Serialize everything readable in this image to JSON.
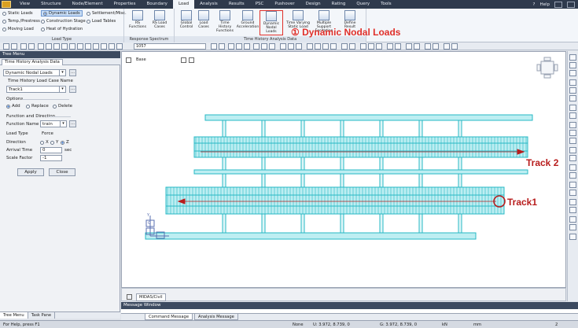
{
  "menubar": {
    "items": [
      "View",
      "Structure",
      "Node/Element",
      "Properties",
      "Boundary",
      "Load",
      "Analysis",
      "Results",
      "PSC",
      "Pushover",
      "Design",
      "Rating",
      "Query",
      "Tools"
    ],
    "active_index": 5,
    "help_label": "Help"
  },
  "ribbon": {
    "load_type": {
      "title": "Load Type",
      "items": [
        "Static Loads",
        "Dynamic Loads",
        "Settlement/Misc.",
        "Temp./Prestress",
        "Construction Stage",
        "Load Tables",
        "Moving Load",
        "Heat of Hydration"
      ],
      "selected": "Dynamic Loads"
    },
    "response_spectrum": {
      "title": "Response Spectrum Data",
      "buttons": [
        "RS Functions",
        "RS Load Cases"
      ]
    },
    "time_history": {
      "title": "Time History Analysis Data",
      "buttons": [
        "Global Control",
        "Load Cases",
        "Time History Functions",
        "Ground Acceleration",
        "Dynamic Nodal Loads",
        "Time Varying Static Load",
        "Multiple Support Excitation",
        "Define Result"
      ]
    },
    "callout": "① Dynamic Nodal Loads"
  },
  "toolbar": {
    "field_value": "1057"
  },
  "tree_menu": {
    "title": "Tree Menu",
    "tab": "Time History Analysis Data",
    "dropdown": "Dynamic Nodal Loads",
    "load_case_label": "Time History Load Case Name",
    "load_case_value": "Track1",
    "options_label": "Options",
    "options": [
      "Add",
      "Replace",
      "Delete"
    ],
    "options_selected": "Add",
    "function_dir_label": "Function and Direction",
    "function_name_label": "Function Name",
    "function_name_value": "train",
    "load_type_label": "Load Type",
    "load_type_value": "Force",
    "direction_label": "Direction",
    "directions": [
      "X",
      "Y",
      "Z"
    ],
    "direction_selected": "Z",
    "arrival_time_label": "Arrival Time",
    "arrival_time_value": "0",
    "arrival_time_unit": "sec",
    "scale_factor_label": "Scale Factor",
    "scale_factor_value": "-1",
    "apply_label": "Apply",
    "close_label": "Close",
    "bottom_tabs": [
      "Tree Menu",
      "Task Pane"
    ]
  },
  "view": {
    "base_label": "Base",
    "track2_label": "Track 2",
    "track1_label": "Track1",
    "tab_label": "MIDAS/Civil",
    "colors": {
      "mesh": "#27b8c4",
      "fill": "#bdeef2",
      "arrow": "#b81d1d"
    }
  },
  "message_window": {
    "title": "Message Window",
    "tabs": [
      "Command Message",
      "Analysis Message"
    ]
  },
  "status": {
    "help": "For Help, press F1",
    "none": "None",
    "u": "U: 3.972, 8.739, 0",
    "g": "G: 3.972, 8.739, 0",
    "unit1": "kN",
    "unit2": "mm",
    "num": "2"
  }
}
